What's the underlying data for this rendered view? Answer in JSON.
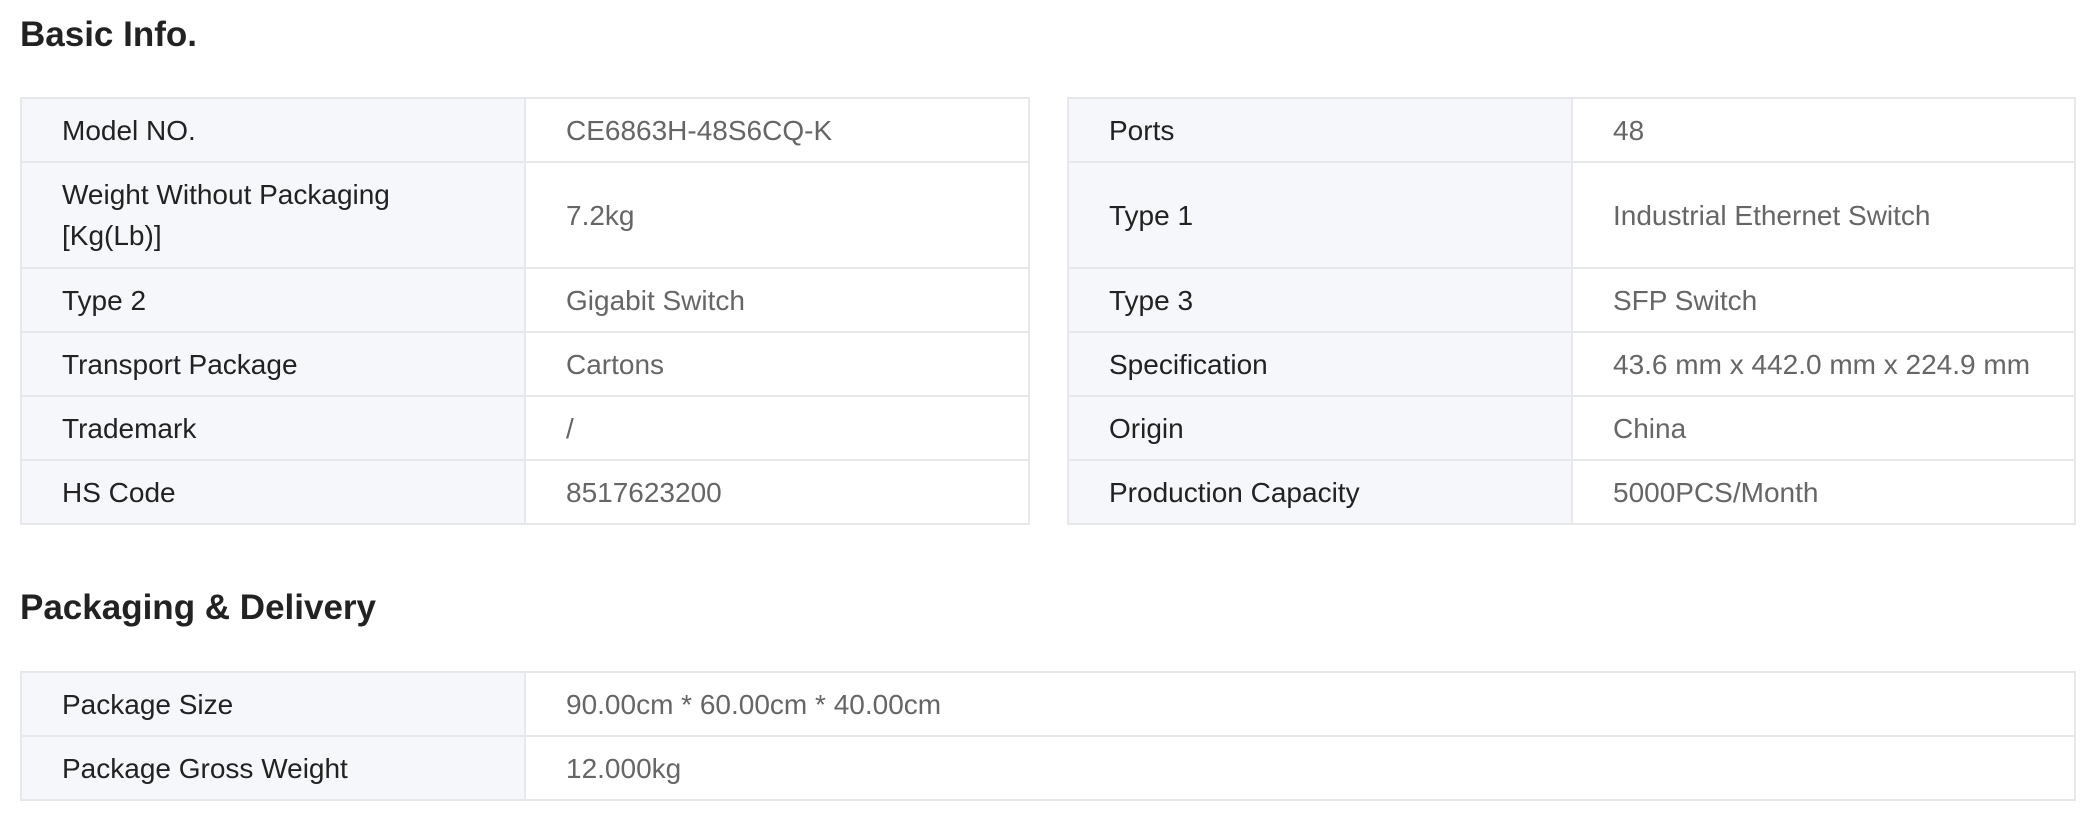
{
  "basic_info": {
    "title": "Basic Info.",
    "left_rows": [
      {
        "label": "Model NO.",
        "value": "CE6863H-48S6CQ-K"
      },
      {
        "label": "Weight Without Packaging [Kg(Lb)]",
        "value": "7.2kg"
      },
      {
        "label": "Type 2",
        "value": "Gigabit Switch"
      },
      {
        "label": "Transport Package",
        "value": "Cartons"
      },
      {
        "label": "Trademark",
        "value": "/"
      },
      {
        "label": "HS Code",
        "value": "8517623200"
      }
    ],
    "right_rows": [
      {
        "label": "Ports",
        "value": "48"
      },
      {
        "label": "Type 1",
        "value": "Industrial Ethernet Switch"
      },
      {
        "label": "Type 3",
        "value": "SFP Switch"
      },
      {
        "label": "Specification",
        "value": "43.6 mm x 442.0 mm x 224.9 mm"
      },
      {
        "label": "Origin",
        "value": "China"
      },
      {
        "label": "Production Capacity",
        "value": "5000PCS/Month"
      }
    ]
  },
  "packaging": {
    "title": "Packaging & Delivery",
    "rows": [
      {
        "label": "Package Size",
        "value": "90.00cm * 60.00cm * 40.00cm"
      },
      {
        "label": "Package Gross Weight",
        "value": "12.000kg"
      }
    ]
  }
}
